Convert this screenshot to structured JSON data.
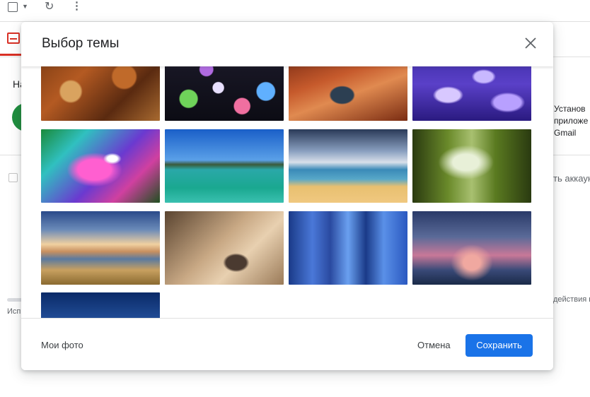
{
  "background": {
    "heading": "На",
    "install_text": "Установ приложе Gmail",
    "account_text": "ть аккаун",
    "activity_text": "действия в",
    "used_text": "Исп"
  },
  "dialog": {
    "title": "Выбор темы",
    "close_icon": "close-icon",
    "themes": [
      {
        "name": "autumn-leaves"
      },
      {
        "name": "bokeh-lights"
      },
      {
        "name": "canyon-river"
      },
      {
        "name": "jellyfish"
      },
      {
        "name": "water-drops-rainbow"
      },
      {
        "name": "lake-island"
      },
      {
        "name": "beach-clouds"
      },
      {
        "name": "forest-stream"
      },
      {
        "name": "golden-gate-coast"
      },
      {
        "name": "desert-rock"
      },
      {
        "name": "city-skyscrapers"
      },
      {
        "name": "stormy-sky"
      },
      {
        "name": "night-cliffs"
      }
    ],
    "footer": {
      "my_photos_label": "Мои фото",
      "cancel_label": "Отмена",
      "save_label": "Сохранить"
    }
  },
  "colors": {
    "primary": "#1a73e8",
    "accent_red": "#d93025",
    "green": "#1e8e3e"
  }
}
